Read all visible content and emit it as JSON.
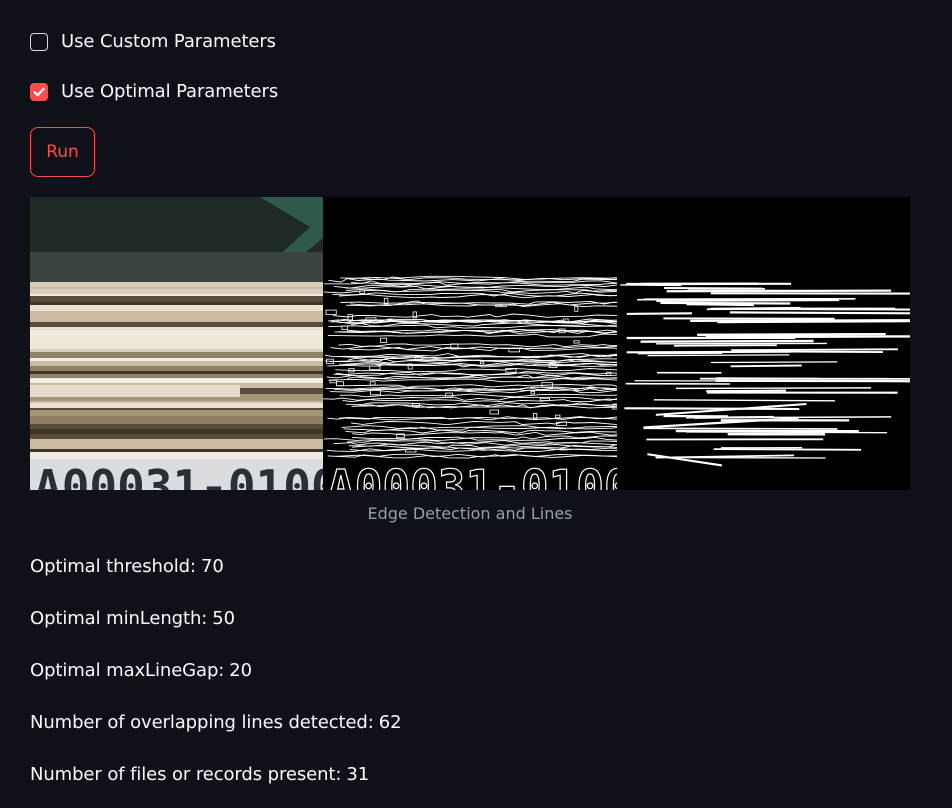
{
  "options": {
    "custom_label": "Use Custom Parameters",
    "custom_checked": false,
    "optimal_label": "Use Optimal Parameters",
    "optimal_checked": true
  },
  "run_button_label": "Run",
  "figure": {
    "caption": "Edge Detection and Lines",
    "image_text": "A00031-0100"
  },
  "results": [
    {
      "label": "Optimal threshold:",
      "value": "70"
    },
    {
      "label": "Optimal minLength:",
      "value": "50"
    },
    {
      "label": "Optimal maxLineGap:",
      "value": "20"
    },
    {
      "label": "Number of overlapping lines detected:",
      "value": "62"
    },
    {
      "label": "Number of files or records present:",
      "value": "31"
    }
  ],
  "colors": {
    "background": "#0e1117",
    "accent": "#ff4b4b",
    "text": "#fafafa",
    "caption": "#9a9ea6"
  }
}
